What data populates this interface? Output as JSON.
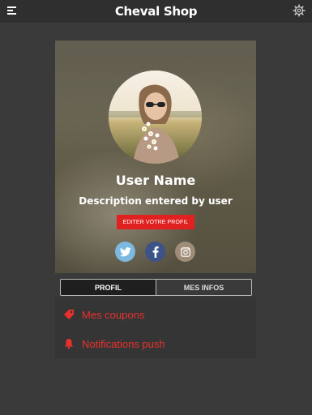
{
  "app": {
    "title": "Cheval Shop"
  },
  "toolbar": {
    "menu_icon": "hamburger-menu-icon",
    "settings_icon": "gear-icon"
  },
  "profile": {
    "name": "User Name",
    "description": "Description entered by user",
    "edit_label": "EDITER VOTRE PROFIL"
  },
  "social": [
    {
      "network": "twitter",
      "icon": "twitter-icon",
      "color": "#7bb9e0"
    },
    {
      "network": "facebook",
      "icon": "facebook-icon",
      "color": "#3c5387"
    },
    {
      "network": "instagram",
      "icon": "instagram-icon",
      "color": "#a08d78"
    }
  ],
  "tabs": [
    {
      "label": "PROFIL",
      "active": true
    },
    {
      "label": "MES INFOS",
      "active": false
    }
  ],
  "menu": {
    "items": [
      {
        "label": "Mes coupons",
        "icon": "tag-icon"
      },
      {
        "label": "Notifications push",
        "icon": "bell-icon"
      }
    ]
  },
  "colors": {
    "accent": "#e0211f",
    "link_red": "#e8312d",
    "background": "#3a3a3a",
    "topbar": "#2f2f2f"
  }
}
